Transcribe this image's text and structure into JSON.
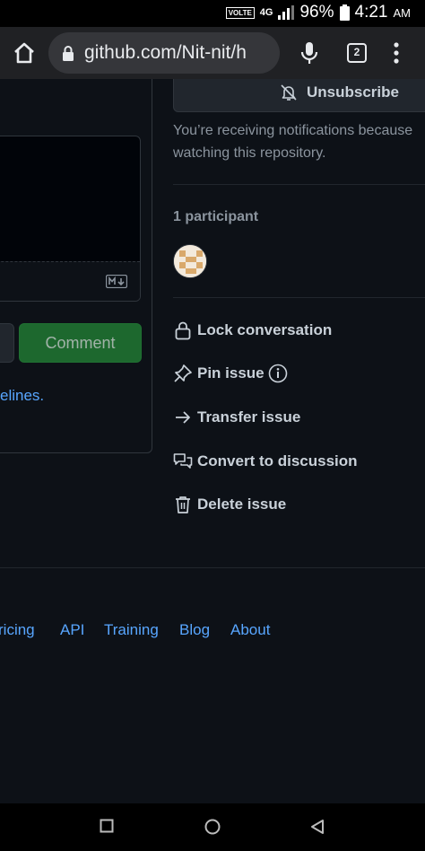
{
  "status_bar": {
    "volte": "VOLTE",
    "network": "4G",
    "battery": "96%",
    "time": "4:21",
    "ampm": "AM"
  },
  "browser": {
    "url": "github.com/Nit-nit/h",
    "tab_count": "2"
  },
  "comment_form": {
    "submit_label": "Comment",
    "guidelines_link": "elines."
  },
  "sidebar": {
    "unsubscribe_label": "Unsubscribe",
    "notification_text_line1": "You’re receiving notifications because",
    "notification_text_line2": "watching this repository.",
    "participants_label": "1 participant",
    "actions": [
      {
        "label": "Lock conversation",
        "icon": "lock-icon"
      },
      {
        "label": "Pin issue",
        "icon": "pin-icon"
      },
      {
        "label": "Transfer issue",
        "icon": "arrow-right-icon"
      },
      {
        "label": "Convert to discussion",
        "icon": "comment-discussion-icon"
      },
      {
        "label": "Delete issue",
        "icon": "trash-icon"
      }
    ]
  },
  "footer": {
    "links": [
      "ricing",
      "API",
      "Training",
      "Blog",
      "About"
    ]
  },
  "colors": {
    "background": "#0d1117",
    "link": "#58a6ff",
    "primary_button": "#238636",
    "muted_text": "#8b949e"
  }
}
